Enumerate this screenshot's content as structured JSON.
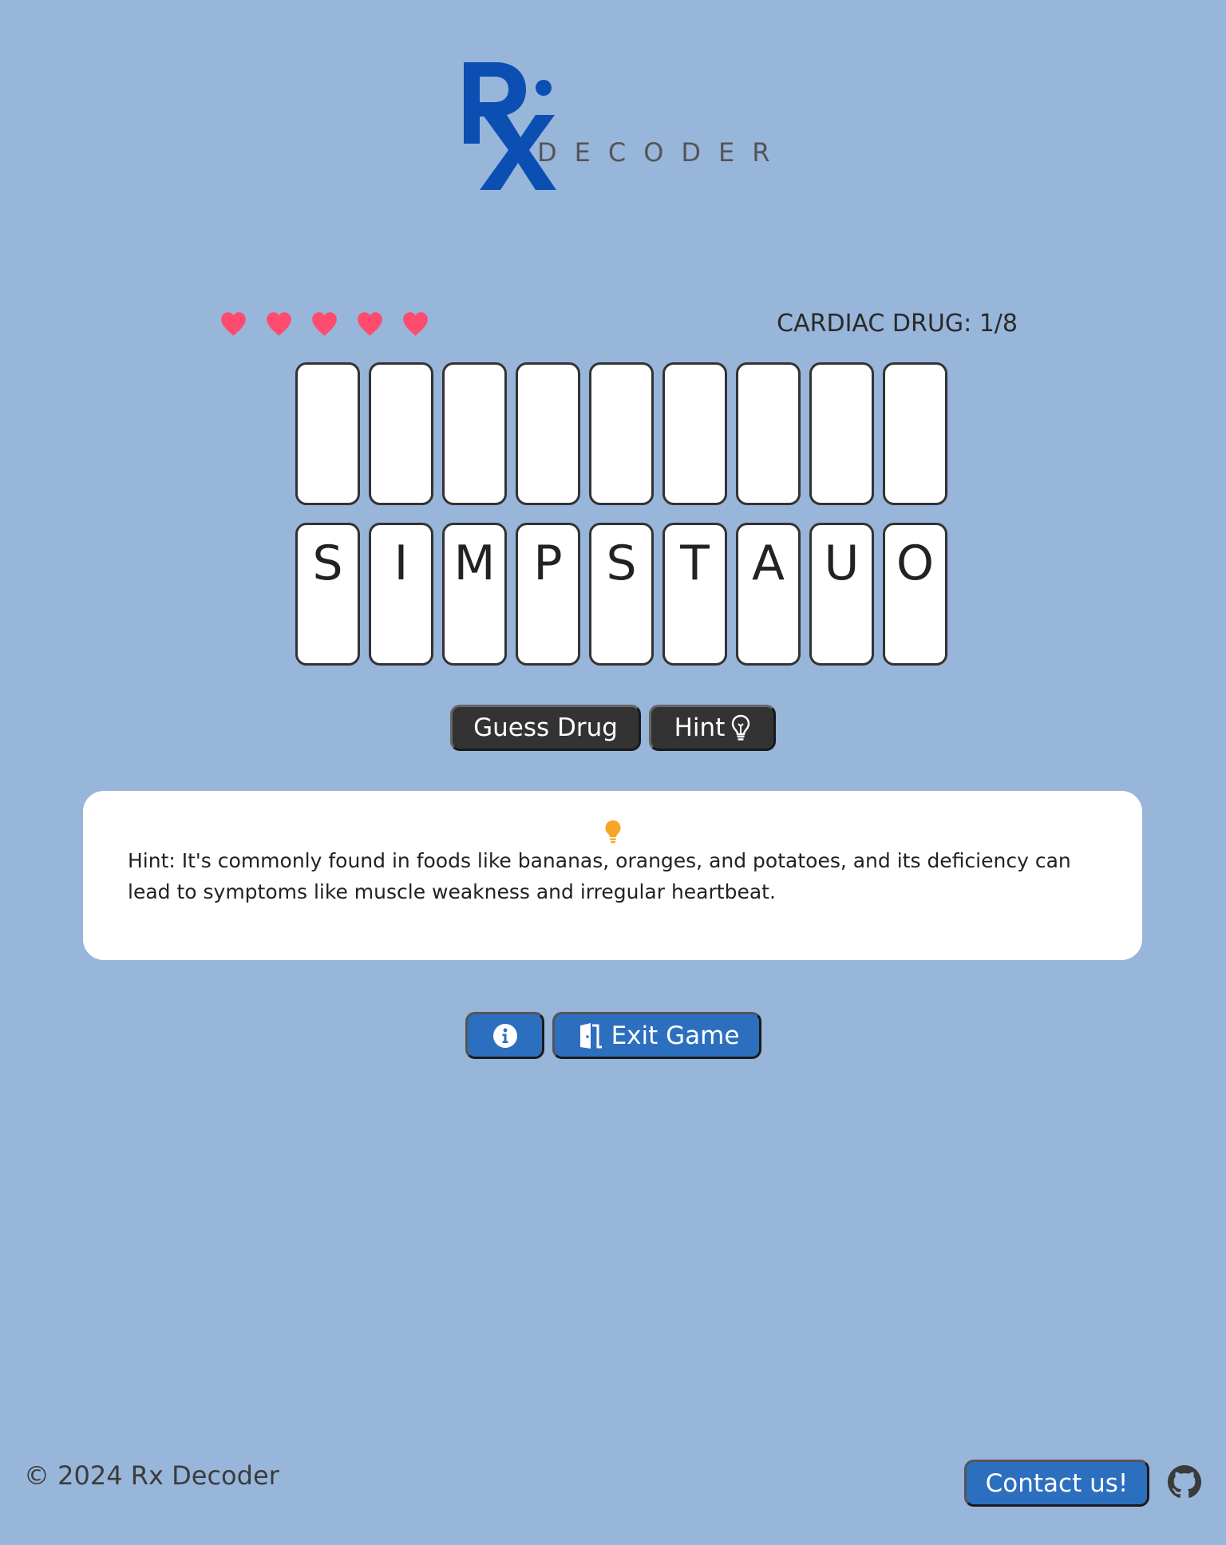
{
  "logo": {
    "mark": "Rx",
    "word": "DECODER",
    "mark_color": "#0b4fb3",
    "word_color": "#555555"
  },
  "status": {
    "lives": 5,
    "heart_color": "#ff4b6e",
    "category": "CARDIAC DRUG: 1/8"
  },
  "answer_slots": [
    "",
    "",
    "",
    "",
    "",
    "",
    "",
    "",
    ""
  ],
  "letter_tiles": [
    "S",
    "I",
    "M",
    "P",
    "S",
    "T",
    "A",
    "U",
    "O"
  ],
  "actions": {
    "guess_label": "Guess Drug",
    "hint_label": "Hint",
    "hint_icon": "lightbulb-outline-icon"
  },
  "hint_panel": {
    "icon": "lightbulb-icon",
    "icon_color": "#f5a623",
    "text": "Hint: It's commonly found in foods like bananas, oranges, and potatoes, and its deficiency can lead to symptoms like muscle weakness and irregular heartbeat."
  },
  "bottom_actions": {
    "info_icon": "info-circle-icon",
    "exit_icon": "door-open-icon",
    "exit_label": "Exit Game"
  },
  "footer": {
    "copyright": "© 2024 Rx Decoder",
    "contact_label": "Contact us!",
    "github_icon": "github-icon"
  },
  "colors": {
    "background": "#98b5da",
    "dark_button": "#333333",
    "blue_button": "#2d6fbf"
  }
}
